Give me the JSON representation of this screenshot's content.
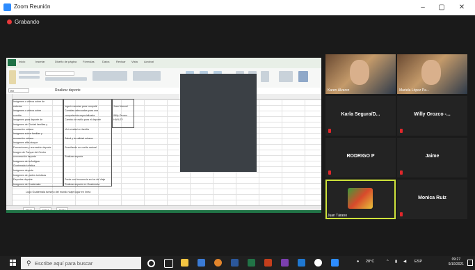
{
  "window": {
    "title": "Zoom Reunión",
    "minimize": "–",
    "maximize": "▢",
    "close": "✕"
  },
  "recording": {
    "label": "Grabando"
  },
  "spreadsheet": {
    "namebox": "B9",
    "formula": "Realizar deporte",
    "tabs": [
      "Archivo",
      "Inicio",
      "Insertar",
      "Diseño de página",
      "Fórmulas",
      "Datos",
      "Revisar",
      "Vista",
      "Acrobat"
    ],
    "rows": [
      {
        "a": "Imágenes o videos sobre de",
        "b": "",
        "c": ""
      },
      {
        "a": "calorías",
        "b": "Ingerir calorías para competir",
        "c": "Juan Manuel"
      },
      {
        "a": "Imágenes o videos sobre",
        "b": "Comidas adecuadas para una",
        "c": ""
      },
      {
        "a": "comida",
        "b": "competencia especializada",
        "c": "Willy Orozco"
      },
      {
        "a": "Imágenes para deporte de",
        "b": "Cambio de estilo para el deporte",
        "c": "HAYLEY"
      },
      {
        "a": "Imágenes de Ciudad familias y",
        "b": "",
        "c": ""
      },
      {
        "a": "recreación urbana",
        "b": "Vivir ciudad en familia",
        "c": ""
      },
      {
        "a": "Imágenes sobre familias y",
        "b": "",
        "c": ""
      },
      {
        "a": "recreación urbana",
        "b": "Salud y la calidad urbana",
        "c": ""
      },
      {
        "a": "Imágenes afila ataque",
        "b": "",
        "c": ""
      },
      {
        "a": "Formaciones y recreación deporte",
        "b": "Enseñando en vuelta natural",
        "c": ""
      },
      {
        "a": "Imagen de Parque del Centro",
        "b": "",
        "c": ""
      },
      {
        "a": "a recreación deporte",
        "b": "Realizar deporte",
        "c": ""
      },
      {
        "a": "Imágenes de la Antigua",
        "b": "",
        "c": ""
      },
      {
        "a": "Guatemala turística",
        "b": "",
        "c": ""
      },
      {
        "a": "Imágenes deporte",
        "b": "",
        "c": ""
      },
      {
        "a": "Imágenes de partes turísticas",
        "b": "",
        "c": ""
      },
      {
        "a": "Deportes deporte",
        "b": "Ponte con frecuencia en los de Viaje",
        "c": ""
      },
      {
        "a": "Imágenes de Guatemala",
        "b": "Realizar deporte en Guatemala",
        "c": ""
      }
    ],
    "note": "Lugo Guatemala turismo del mundo viaje lugar en línea",
    "sheets": [
      "Hoja1",
      "Hoja2",
      "Hoja3"
    ]
  },
  "participants": [
    {
      "name": "Karen Álvarez",
      "type": "video",
      "muted": false
    },
    {
      "name": "Mariela López Pa...",
      "type": "video",
      "muted": false
    },
    {
      "name": "Karla Segura/D...",
      "type": "name",
      "muted": true
    },
    {
      "name": "Willy Orozco -...",
      "type": "name",
      "muted": true
    },
    {
      "name": "RODRIGO P",
      "type": "name",
      "muted": true
    },
    {
      "name": "Jaime",
      "type": "name",
      "muted": true
    },
    {
      "name": "Juan Tárano",
      "type": "avatar",
      "muted": false,
      "active": true
    },
    {
      "name": "Monica Ruiz",
      "type": "name",
      "muted": true
    }
  ],
  "taskbar": {
    "search_placeholder": "Escribe aquí para buscar",
    "weather": "28°C",
    "clock_time": "09:27",
    "clock_date": "9/10/2021",
    "lang": "ESP"
  },
  "colors": {
    "zoom_blue": "#2d8cff",
    "excel_green": "#217346",
    "active_speaker": "#cfe33b",
    "mute_red": "#e0272b"
  }
}
